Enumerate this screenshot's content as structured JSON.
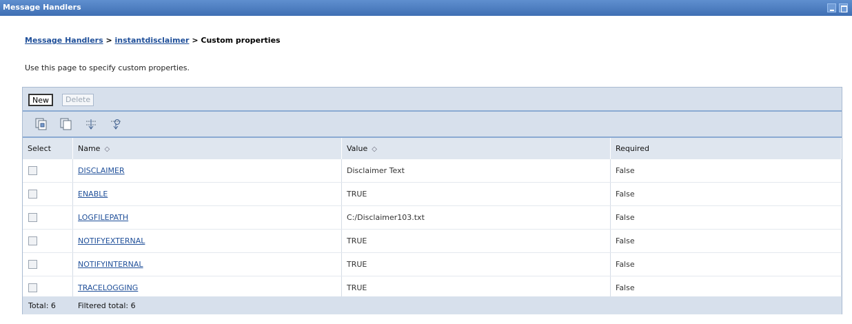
{
  "window": {
    "title": "Message Handlers"
  },
  "breadcrumb": {
    "link1": "Message Handlers",
    "sep1": " > ",
    "link2": "instantdisclaimer",
    "sep2": " > ",
    "current": "Custom properties"
  },
  "description": "Use this page to specify custom properties.",
  "buttons": {
    "new": "New",
    "delete": "Delete"
  },
  "toolbar_icons": [
    "select-all-icon",
    "deselect-all-icon",
    "show-filter-icon",
    "clear-filter-icon"
  ],
  "table": {
    "headers": {
      "select": "Select",
      "name": "Name",
      "value": "Value",
      "required": "Required"
    },
    "rows": [
      {
        "name": "DISCLAIMER",
        "value": "Disclaimer Text",
        "required": "False"
      },
      {
        "name": "ENABLE",
        "value": "TRUE",
        "required": "False"
      },
      {
        "name": "LOGFILEPATH",
        "value": "C:/Disclaimer103.txt",
        "required": "False"
      },
      {
        "name": "NOTIFYEXTERNAL",
        "value": "TRUE",
        "required": "False"
      },
      {
        "name": "NOTIFYINTERNAL",
        "value": "TRUE",
        "required": "False"
      },
      {
        "name": "TRACELOGGING",
        "value": "TRUE",
        "required": "False"
      }
    ]
  },
  "totals": {
    "total": "Total: 6",
    "filtered": "Filtered total: 6"
  },
  "colors": {
    "titlebar": "#4a7bbf",
    "link": "#1f4f99",
    "panel": "#d7e0ec"
  }
}
